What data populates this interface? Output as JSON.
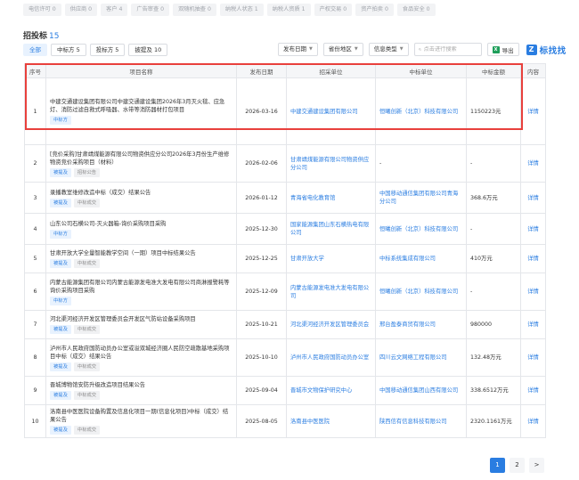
{
  "top_tabs": [
    "电信许可 0",
    "供应商 0",
    "客户 4",
    "广告审查 0",
    "双随机抽查 0",
    "纳税人状态 1",
    "纳税人资质 1",
    "产权交易 0",
    "资产拍卖 0",
    "食品安全 0"
  ],
  "section": {
    "title": "招投标",
    "count": "15"
  },
  "filters": [
    {
      "label": "全部",
      "active": true
    },
    {
      "label": "中标方 5",
      "active": false
    },
    {
      "label": "投标方 5",
      "active": false
    },
    {
      "label": "披提及 10",
      "active": false
    }
  ],
  "toolbar": {
    "date_filter": "发布日期",
    "region_filter": "省份地区",
    "type_filter": "信息类型",
    "search_placeholder": "点击进行搜索",
    "export_label": "导出",
    "brand": "标找找"
  },
  "table": {
    "headers": [
      "序号",
      "项目名称",
      "发布日期",
      "招采单位",
      "中标单位",
      "中标金额",
      "内容"
    ],
    "rows": [
      {
        "no": "1",
        "name": "中建交通建设集团有限公司中建交通建设集团2026年3月灭火毯、应急灯、消防过滤自救式呼吸器、水带等消防器材打包项目",
        "tags": [
          "中标方"
        ],
        "date": "2026-03-16",
        "buyer": "中建交通建设集团有限公司",
        "winner": "恒曦创新（北京）科技有限公司",
        "amount": "1150223元",
        "op": "详情"
      },
      {
        "no": "2",
        "name": "[竞价采购]甘肃靖煤能源有限公司物资供应分公司2026年3月份生产维修物资竞价采购项目（材料）",
        "tags": [
          "被提及",
          "招标公告"
        ],
        "date": "2026-02-06",
        "buyer": "甘肃靖煤能源有限公司物资供应分公司",
        "winner": "-",
        "amount": "-",
        "op": "详情"
      },
      {
        "no": "3",
        "name": "录播教室维修改造中标（成交）结果公告",
        "tags": [
          "被提及",
          "中标成交"
        ],
        "date": "2026-01-12",
        "buyer": "青海省电化教育馆",
        "winner": "中国移动通信集团有限公司青海分公司",
        "amount": "368.6万元",
        "op": "详情"
      },
      {
        "no": "4",
        "name": "山东公司石横公司-灭火器箱-询价采购项目采购",
        "tags": [
          "中标方"
        ],
        "date": "2025-12-30",
        "buyer": "国家能源集团山东石横热电有限公司",
        "winner": "恒曦创新（北京）科技有限公司",
        "amount": "-",
        "op": "详情"
      },
      {
        "no": "5",
        "name": "甘肃开放大学全量智能教学空间（一期）项目中标结果公告",
        "tags": [
          "被提及",
          "中标成交"
        ],
        "date": "2025-12-25",
        "buyer": "甘肃开放大学",
        "winner": "中标系统集成有限公司",
        "amount": "410万元",
        "op": "详情"
      },
      {
        "no": "6",
        "name": "内蒙古能源集团有限公司内蒙古能源发电准大发电有限公司商淋报警耗等询价采购项目采购",
        "tags": [
          "中标方"
        ],
        "date": "2025-12-09",
        "buyer": "内蒙古能源发电准大发电有限公司",
        "winner": "恒曦创新（北京）科技有限公司",
        "amount": "-",
        "op": "详情"
      },
      {
        "no": "7",
        "name": "河北渠河经济开发区管理委员会开发区气防站设备采购项目",
        "tags": [
          "被提及",
          "中标成交"
        ],
        "date": "2025-10-21",
        "buyer": "河北渠河经济开发区管理委员会",
        "winner": "邢台盈泰商贸有限公司",
        "amount": "980000",
        "op": "详情"
      },
      {
        "no": "8",
        "name": "泸州市人民政府国防动员办公室或溢双城经济圈人民防空疏散基地采购项目中标（成交）结果公告",
        "tags": [
          "被提及",
          "中标成交"
        ],
        "date": "2025-10-10",
        "buyer": "泸州市人民政府国防动员办公室",
        "winner": "四川云文网络工程有限公司",
        "amount": "132.48万元",
        "op": "详情"
      },
      {
        "no": "9",
        "name": "晋城博物馆安防升级改造项目结果公告",
        "tags": [
          "被提及",
          "中标成交"
        ],
        "date": "2025-09-04",
        "buyer": "晋城市文物保护研究中心",
        "winner": "中国移动通信集团山西有限公司",
        "amount": "338.6512万元",
        "op": "详情"
      },
      {
        "no": "10",
        "name": "洛南县中医医院设备购置及信息化项目一期(信息化项目)中标（成交）结果公告",
        "tags": [
          "被提及",
          "中标成交"
        ],
        "date": "2025-08-05",
        "buyer": "洛南县中医医院",
        "winner": "陕西信有信息科技有限公司",
        "amount": "2320.1161万元",
        "op": "详情"
      }
    ]
  },
  "pagination": {
    "pages": [
      "1",
      "2"
    ],
    "next": ">"
  },
  "colors": {
    "accent": "#2a7de1",
    "highlight": "#e8403c"
  }
}
